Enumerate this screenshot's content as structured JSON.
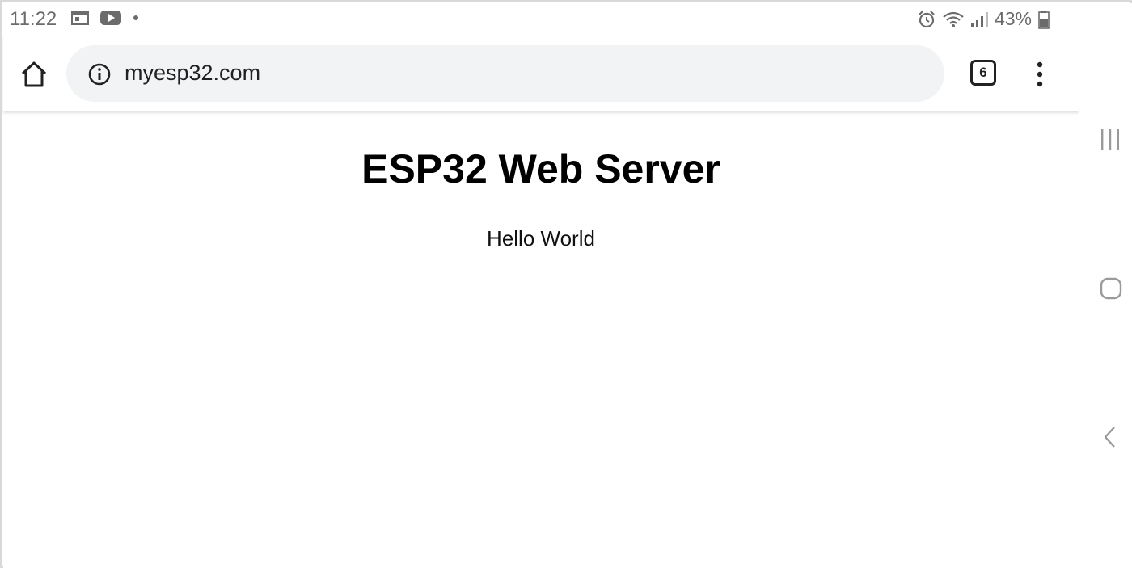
{
  "status_bar": {
    "time": "11:22",
    "left_icons": [
      "calendar-icon",
      "youtube-icon",
      "notification-dot-icon"
    ],
    "right_icons": [
      "alarm-icon",
      "wifi-icon",
      "signal-icon",
      "battery-icon"
    ],
    "battery_percent": "43%"
  },
  "browser": {
    "url": "myesp32.com",
    "tab_count": "6"
  },
  "page": {
    "heading": "ESP32 Web Server",
    "text": "Hello World"
  },
  "nav_bar": {
    "buttons": [
      "recent-apps-icon",
      "home-icon",
      "back-icon"
    ]
  },
  "colors": {
    "url_bar_bg": "#f1f3f4",
    "status_text": "#6b6b6b"
  }
}
